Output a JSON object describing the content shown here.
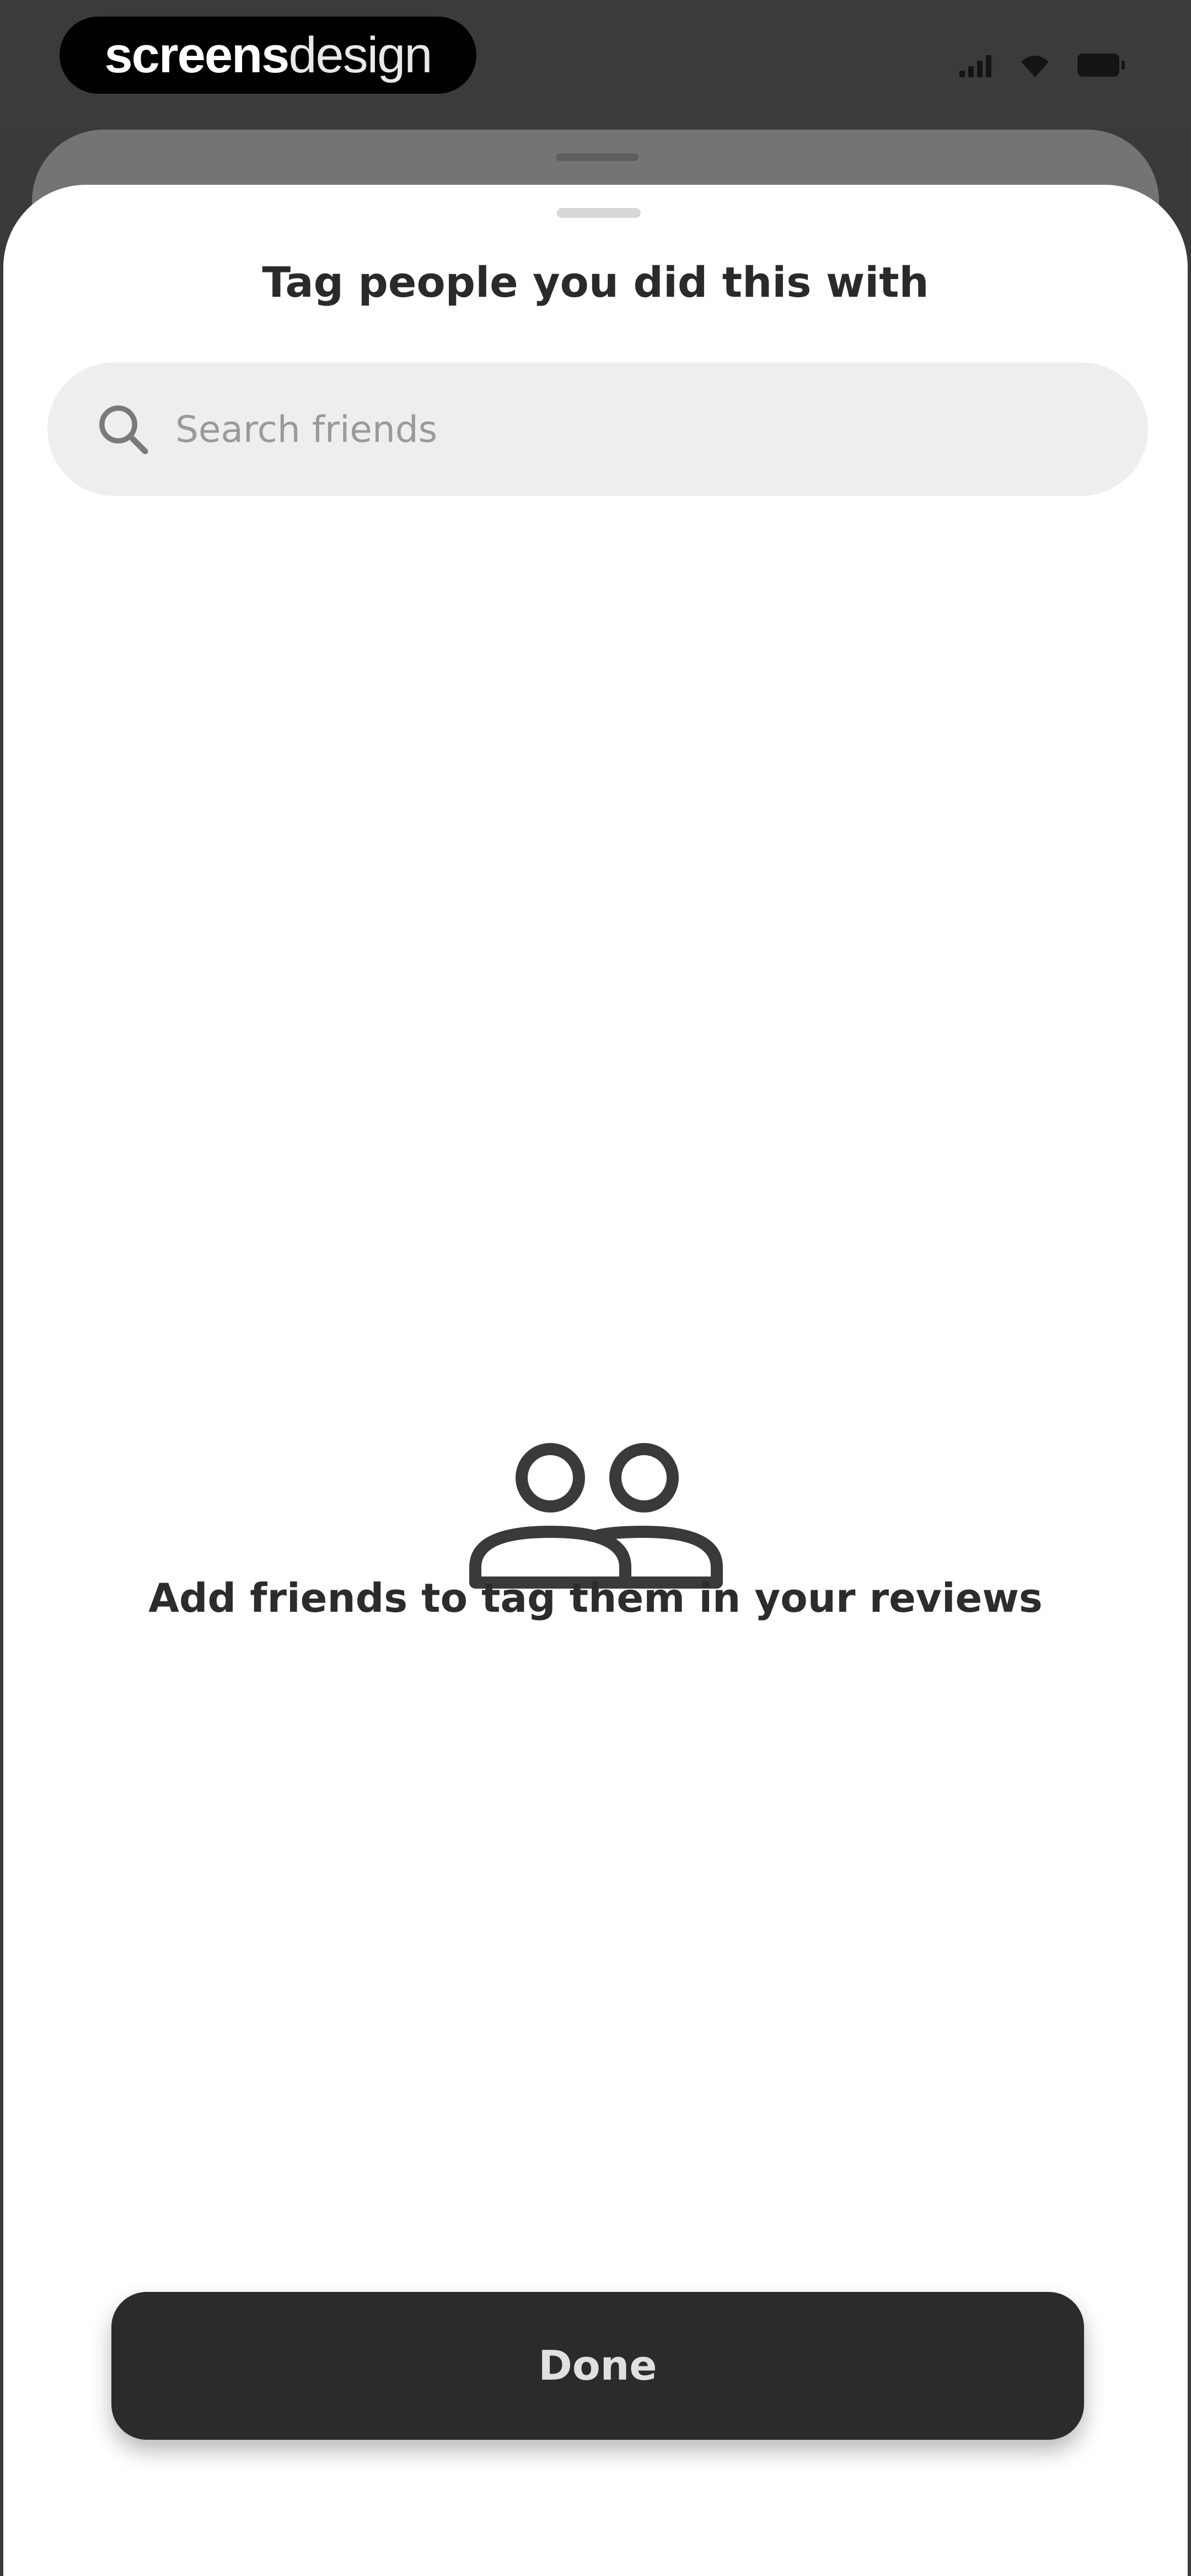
{
  "watermark": {
    "brand_strong": "screens",
    "brand_light": "design"
  },
  "status_bar": {
    "icons": [
      "signal-icon",
      "wifi-icon",
      "battery-icon"
    ]
  },
  "sheet": {
    "title": "Tag people you did this with",
    "search": {
      "placeholder": "Search friends",
      "value": "",
      "icon": "search-icon"
    },
    "empty_state": {
      "icon": "people-icon",
      "message": "Add friends to tag them in your reviews"
    },
    "done_label": "Done"
  },
  "colors": {
    "sheet_background": "#ffffff",
    "search_background": "#eeeeee",
    "button_background": "#2b2b2b",
    "button_text": "#e0e0e0",
    "title_text": "#2a2a2a"
  }
}
